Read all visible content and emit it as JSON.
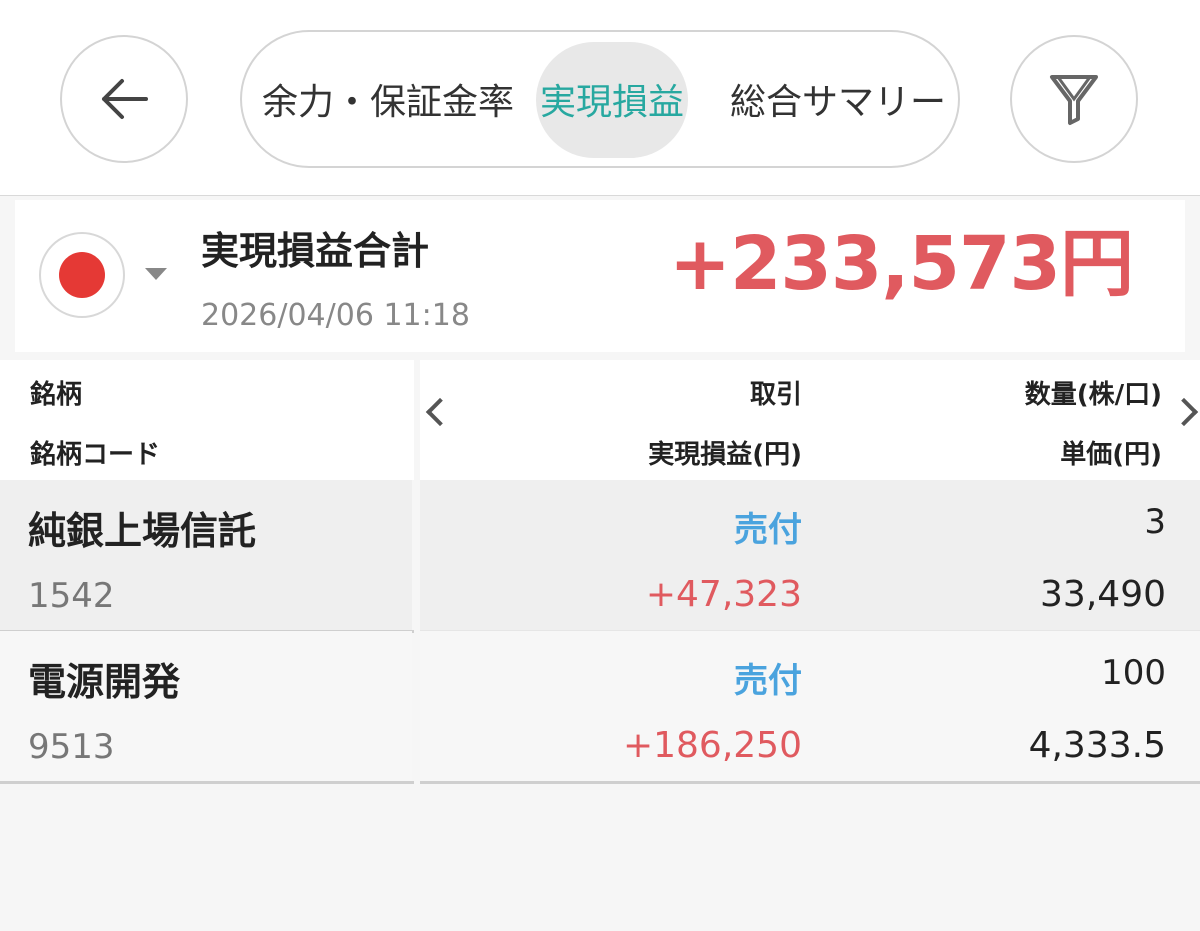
{
  "header": {
    "tabs": [
      {
        "label": "余力・保証金率",
        "active": false
      },
      {
        "label": "実現損益",
        "active": true
      },
      {
        "label": "総合サマリー",
        "active": false
      }
    ],
    "back_icon": "arrow-left-icon",
    "filter_icon": "filter-icon"
  },
  "summary": {
    "market_flag": "japan-flag-icon",
    "label": "実現損益合計",
    "value": "+233,573円",
    "timestamp": "2026/04/06 11:18"
  },
  "table": {
    "headers": {
      "name": "銘柄",
      "code": "銘柄コード",
      "trade": "取引",
      "realized_pl": "実現損益(円)",
      "quantity": "数量(株/口)",
      "unit_price": "単価(円)"
    },
    "rows": [
      {
        "name": "純銀上場信託",
        "code": "1542",
        "trade": "売付",
        "realized_pl": "+47,323",
        "quantity": "3",
        "unit_price": "33,490"
      },
      {
        "name": "電源開発",
        "code": "9513",
        "trade": "売付",
        "realized_pl": "+186,250",
        "quantity": "100",
        "unit_price": "4,333.5"
      }
    ]
  },
  "colors": {
    "accent_teal": "#27a8a0",
    "profit_red": "#e05a5f",
    "trade_blue": "#4aa3de",
    "flag_red": "#e53935"
  }
}
